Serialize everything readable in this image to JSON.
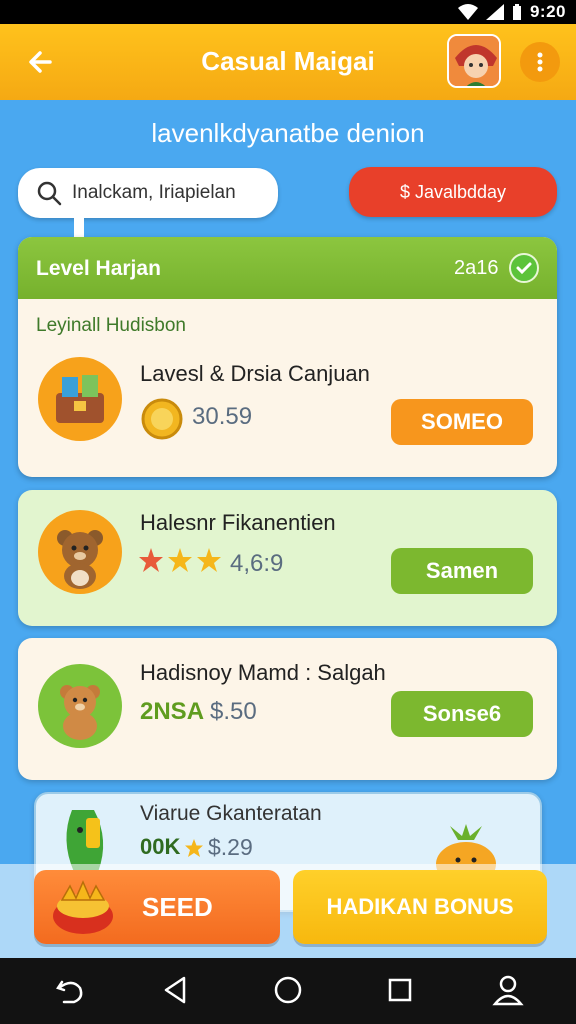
{
  "status": {
    "time": "9:20"
  },
  "appbar": {
    "title": "Casual Maigai"
  },
  "headline": "lavenlkdyanatbe denion",
  "search": {
    "placeholder": "Inalckam, Iriapielan"
  },
  "promo_button": "$ Javalbdday",
  "panel": {
    "title": "Level Harjan",
    "year": "2a16",
    "subtitle": "Leyinall Hudisbon"
  },
  "items": [
    {
      "title": "Lavesl & Drsia Canjuan",
      "value": "30.59",
      "button": "SOMEO",
      "color": "#f7961d"
    },
    {
      "title": "Halesnr Fikanentien",
      "value": "4,6:9",
      "button": "Samen",
      "color": "#7cb82f"
    },
    {
      "title": "Hadisnoy Mamd : Salgah",
      "value_prefix": "2NSA",
      "value": "$.50",
      "button": "Sonse6",
      "color": "#7cb82f"
    },
    {
      "title": "Viarue Gkanteratan",
      "value_prefix": "00K",
      "value": "$.29"
    }
  ],
  "actions": {
    "see": "SEED",
    "bonus": "HADIKAN BONUS"
  },
  "colors": {
    "sky": "#4aa8f0",
    "appbar": "#f5a913",
    "green": "#7cb82f",
    "orange": "#f7961d",
    "red": "#e8402a"
  }
}
